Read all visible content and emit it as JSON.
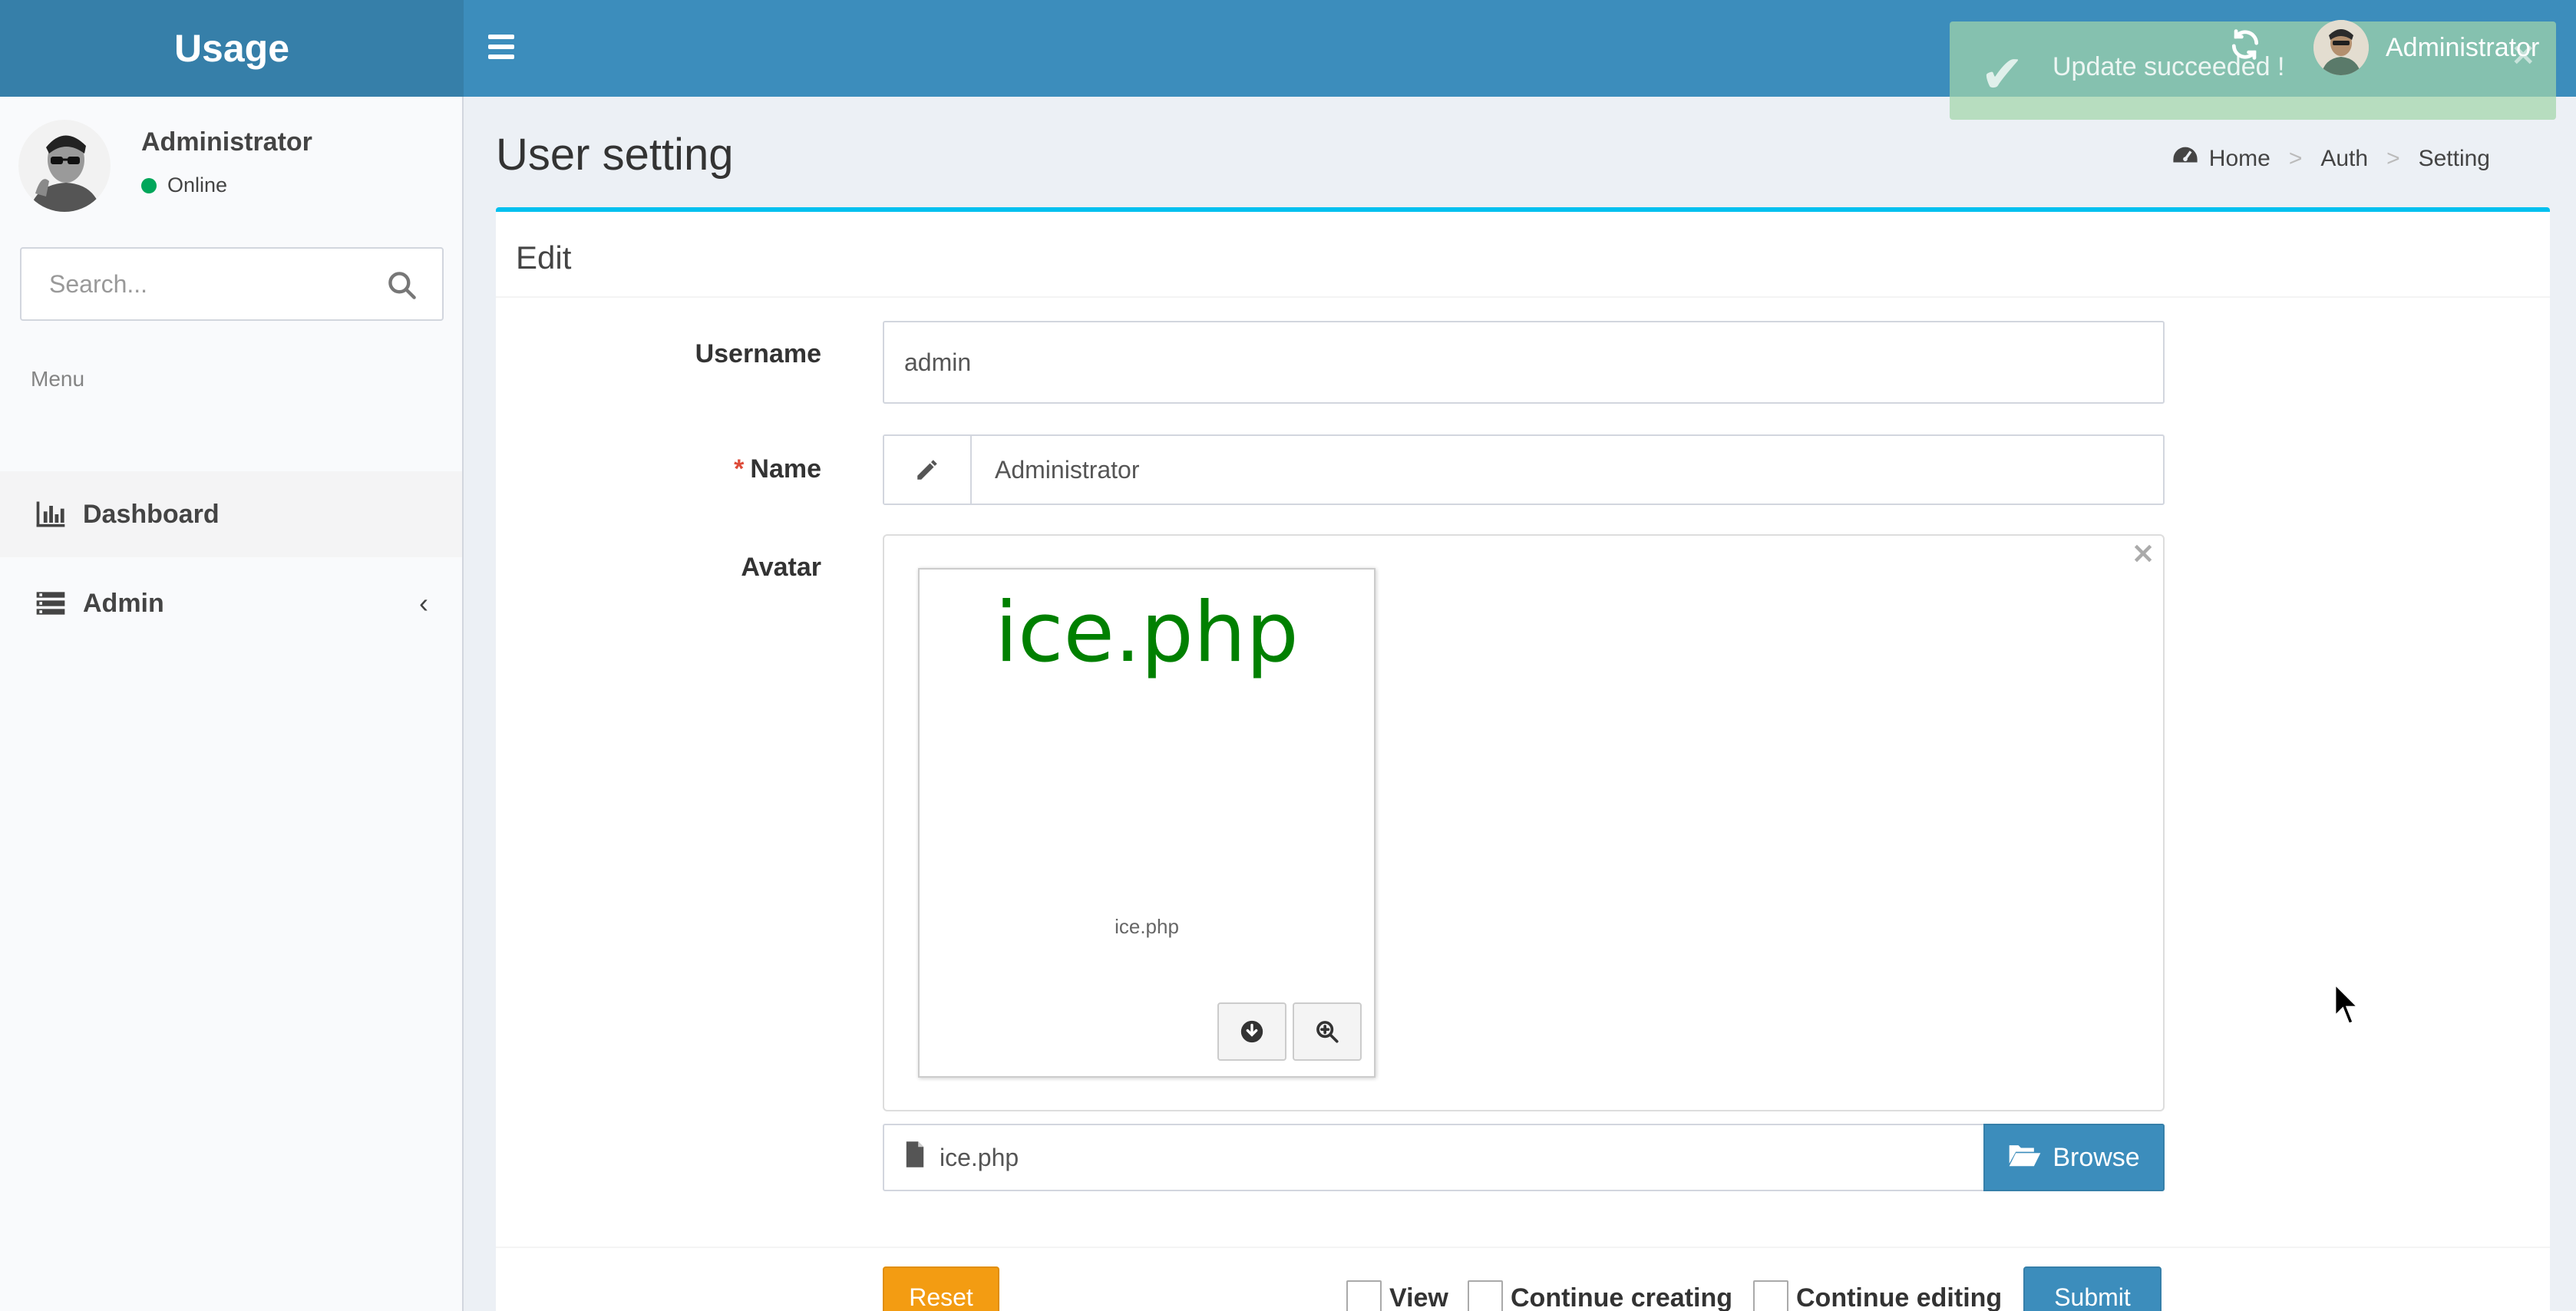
{
  "app": {
    "logo_text": "Usage"
  },
  "header": {
    "menu_toggle_icon": "hamburger-icon",
    "refresh_icon": "refresh-icon",
    "user_name": "Administrator"
  },
  "toast": {
    "message": "Update succeeded !",
    "icon": "check-icon",
    "close": "×"
  },
  "sidebar": {
    "user": {
      "name": "Administrator",
      "status": "Online",
      "status_color": "#00a65a"
    },
    "search": {
      "placeholder": "Search..."
    },
    "menu_header": "Menu",
    "items": [
      {
        "label": "Dashboard",
        "icon": "bar-chart-icon",
        "active": true
      },
      {
        "label": "Admin",
        "icon": "list-icon",
        "caret": "‹"
      }
    ]
  },
  "page": {
    "title": "User setting",
    "breadcrumb": [
      "Home",
      "Auth",
      "Setting"
    ],
    "breadcrumb_sep": ">"
  },
  "form": {
    "box_title": "Edit",
    "username": {
      "label": "Username",
      "value": "admin"
    },
    "name": {
      "required_mark": "*",
      "label": "Name",
      "value": "Administrator"
    },
    "avatar": {
      "label": "Avatar",
      "preview_title": "ice.php",
      "preview_caption": "ice.php",
      "file_name": "ice.php",
      "browse_label": "Browse",
      "remove": "×"
    },
    "actions": {
      "reset": "Reset",
      "view": "View",
      "continue_creating": "Continue creating",
      "continue_editing": "Continue editing",
      "submit": "Submit"
    }
  },
  "colors": {
    "header": "#3c8dbc",
    "logo": "#367fa9",
    "accent_box": "#00c0ef",
    "warning": "#f39c12",
    "preview_text": "#008000"
  }
}
